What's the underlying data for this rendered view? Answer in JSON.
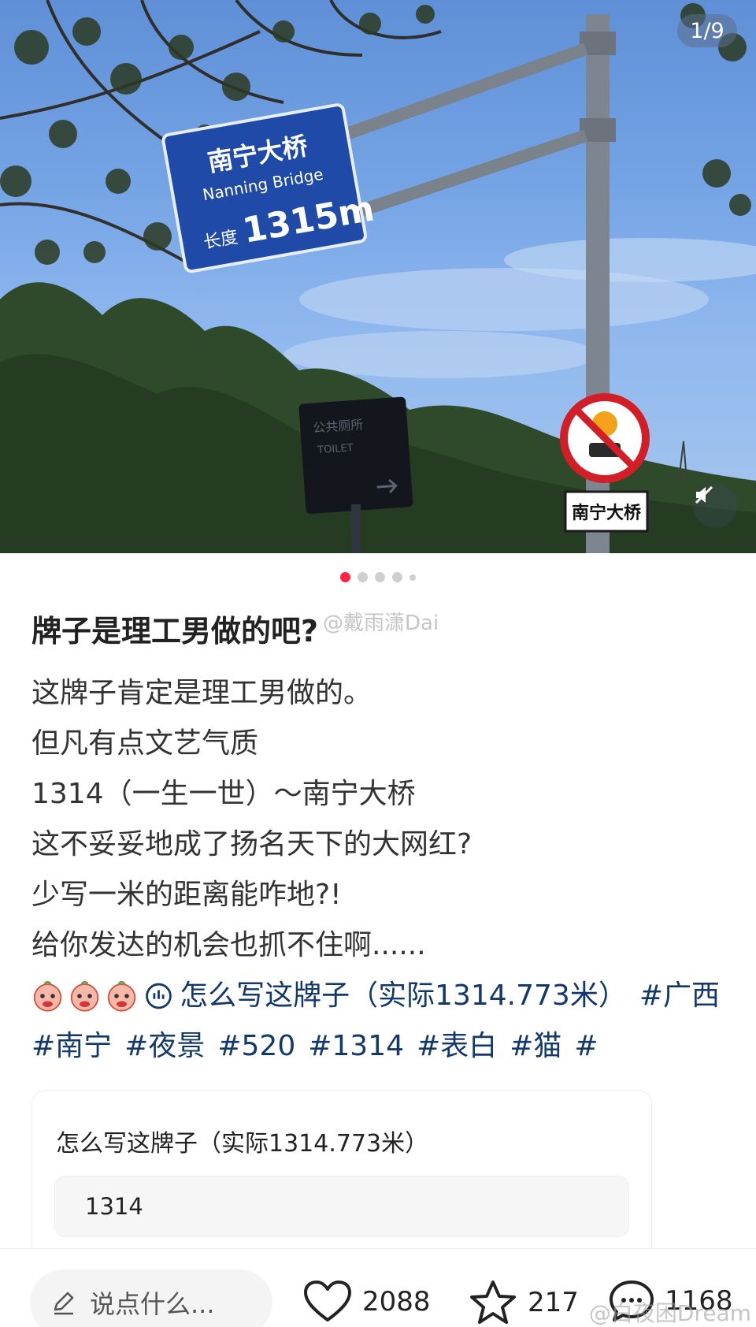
{
  "media": {
    "counter": "1/9",
    "sign_name_cn": "南宁大桥",
    "sign_name_en": "Nanning Bridge",
    "sign_length_label": "长度",
    "sign_length_value": "1315m",
    "small_sign_text": "南宁大桥",
    "toilet_sign_cn": "公共厕所",
    "toilet_sign_en": "TOILET",
    "dots_total": 5,
    "dots_active_index": 0
  },
  "post": {
    "title": "牌子是理工男做的吧?",
    "title_watermark": "@戴雨潇Dai",
    "lines": [
      "这牌子肯定是理工男做的。",
      "但凡有点文艺气质",
      "1314（一生一世）～南宁大桥",
      "这不妥妥地成了扬名天下的大网红?",
      "少写一米的距离能咋地?!",
      "给你发达的机会也抓不住啊......"
    ],
    "vote_link": "怎么写这牌子（实际1314.773米）",
    "tags_line1": [
      "#广西"
    ],
    "tags_line2": [
      "#南宁",
      "#夜景",
      "#520",
      "#1314",
      "#表白",
      "#猫",
      "#"
    ]
  },
  "poll": {
    "question": "怎么写这牌子（实际1314.773米）",
    "option1": "1314"
  },
  "bottom_bar": {
    "comment_placeholder": "说点什么...",
    "likes": "2088",
    "stars": "217",
    "comments": "1168",
    "watermark": "@白夜困Dream"
  },
  "colors": {
    "accent": "#ff2442",
    "link": "#13386c",
    "sky": "#76a5e6",
    "sign_blue": "#1f4aa8"
  }
}
